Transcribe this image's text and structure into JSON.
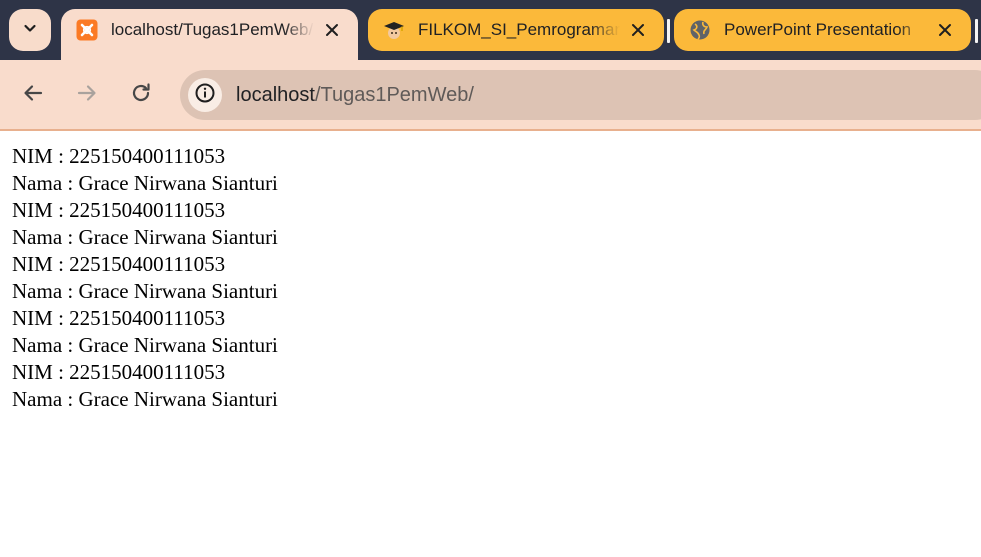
{
  "tabs": [
    {
      "title": "localhost/Tugas1PemWeb/",
      "icon": "xampp-icon",
      "active": true
    },
    {
      "title": "FILKOM_SI_Pemrograman",
      "icon": "graduation-cap-icon",
      "active": false
    },
    {
      "title": "PowerPoint Presentation",
      "icon": "globe-icon",
      "active": false
    }
  ],
  "toolbar": {
    "url_host": "localhost",
    "url_path": "/Tugas1PemWeb/"
  },
  "content": {
    "records": [
      {
        "nim": "NIM : 225150400111053",
        "nama": "Nama : Grace Nirwana Sianturi"
      },
      {
        "nim": "NIM : 225150400111053",
        "nama": "Nama : Grace Nirwana Sianturi"
      },
      {
        "nim": "NIM : 225150400111053",
        "nama": "Nama : Grace Nirwana Sianturi"
      },
      {
        "nim": "NIM : 225150400111053",
        "nama": "Nama : Grace Nirwana Sianturi"
      },
      {
        "nim": "NIM : 225150400111053",
        "nama": "Nama : Grace Nirwana Sianturi"
      }
    ]
  },
  "colors": {
    "tabstrip": "#2e3447",
    "active_tab": "#f9dccc",
    "inactive_tab": "#fbb93a",
    "omnibox": "#ddc3b4"
  }
}
